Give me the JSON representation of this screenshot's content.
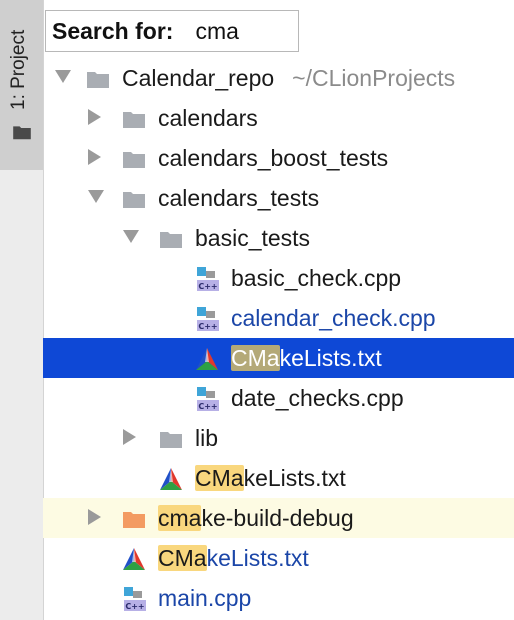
{
  "sidebar": {
    "tab_label": "1: Project"
  },
  "search": {
    "label": "Search for:",
    "value": "cma"
  },
  "tree": {
    "root": {
      "name": "Calendar_repo",
      "path": "~/CLionProjects"
    },
    "calendars": "calendars",
    "calendars_boost_tests": "calendars_boost_tests",
    "calendars_tests": "calendars_tests",
    "basic_tests": "basic_tests",
    "basic_check": "basic_check.cpp",
    "calendar_check": "calendar_check.cpp",
    "cmakelists_basic": {
      "match": "CMa",
      "rest": "keLists.txt"
    },
    "date_checks": "date_checks.cpp",
    "lib": "lib",
    "cmakelists_tests": {
      "match": "CMa",
      "rest": "keLists.txt"
    },
    "cmake_build_debug": {
      "match": "cma",
      "rest": "ke-build-debug"
    },
    "cmakelists_root": {
      "match": "CMa",
      "rest": "keLists.txt"
    },
    "main": "main.cpp"
  },
  "colors": {
    "selection": "#0e48d6",
    "match_highlight": "#f9d77e",
    "modified_text": "#1b46a8",
    "excluded_folder": "#f39b62",
    "folder": "#a9adb3"
  }
}
